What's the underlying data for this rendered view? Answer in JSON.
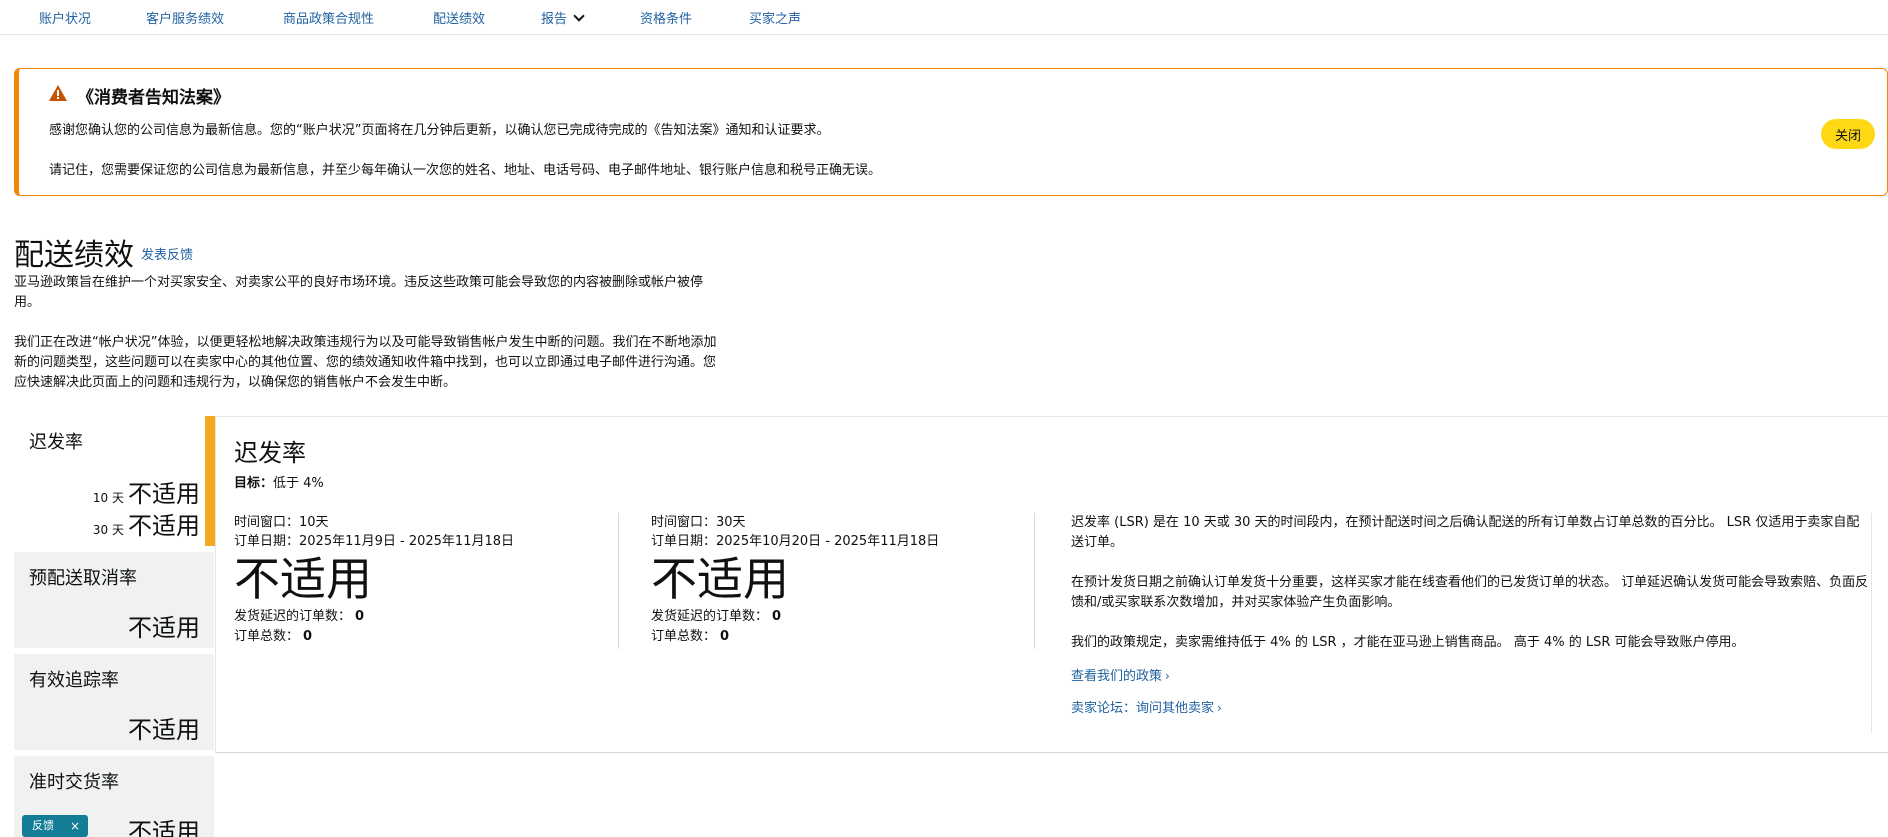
{
  "nav": {
    "items": [
      "账户状况",
      "客户服务绩效",
      "商品政策合规性",
      "配送绩效",
      "报告",
      "资格条件",
      "买家之声"
    ]
  },
  "alert": {
    "title": "《消费者告知法案》",
    "line1": "感谢您确认您的公司信息为最新信息。您的“账户状况”页面将在几分钟后更新，以确认您已完成待完成的《告知法案》通知和认证要求。",
    "line2": "请记住，您需要保证您的公司信息为最新信息，并至少每年确认一次您的姓名、地址、电话号码、电子邮件地址、银行账户信息和税号正确无误。",
    "close_label": "关闭",
    "accent_color": "#f08804"
  },
  "page": {
    "title": "配送绩效",
    "feedback_link": "发表反馈",
    "intro1": "亚马逊政策旨在维护一个对买家安全、对卖家公平的良好市场环境。违反这些政策可能会导致您的内容被删除或帐户被停用。",
    "intro2": "我们正在改进“帐户状况”体验，以便更轻松地解决政策违规行为以及可能导致销售帐户发生中断的问题。我们在不断地添加新的问题类型，这些问题可以在卖家中心的其他位置、您的绩效通知收件箱中找到，也可以立即通过电子邮件进行沟通。您应快速解决此页面上的问题和违规行为，以确保您的销售帐户不会发生中断。"
  },
  "metrics": [
    {
      "name": "迟发率",
      "rows": [
        {
          "period": "10 天",
          "value": "不适用"
        },
        {
          "period": "30 天",
          "value": "不适用"
        }
      ]
    },
    {
      "name": "预配送取消率",
      "value": "不适用"
    },
    {
      "name": "有效追踪率",
      "value": "不适用"
    },
    {
      "name": "准时交货率",
      "value": "不适用"
    }
  ],
  "feedback_pill": {
    "label": "反馈",
    "close": "×"
  },
  "detail": {
    "title": "迟发率",
    "goal_label": "目标：",
    "goal_value": "低于 4%",
    "windows": [
      {
        "window": "时间窗口：10天",
        "dates": "订单日期：2025年11月9日 - 2025年11月18日",
        "big": "不适用",
        "late_label": "发货延迟的订单数：",
        "late_value": "0",
        "total_label": "订单总数：",
        "total_value": "0"
      },
      {
        "window": "时间窗口：30天",
        "dates": "订单日期：2025年10月20日 - 2025年11月18日",
        "big": "不适用",
        "late_label": "发货延迟的订单数：",
        "late_value": "0",
        "total_label": "订单总数：",
        "total_value": "0"
      }
    ],
    "desc1": "迟发率 (LSR) 是在 10 天或 30 天的时间段内，在预计配送时间之后确认配送的所有订单数占订单总数的百分比。 LSR 仅适用于卖家自配送订单。",
    "desc2": "在预计发货日期之前确认订单发货十分重要，这样买家才能在线查看他们的已发货订单的状态。 订单延迟确认发货可能会导致索赔、负面反馈和/或买家联系次数增加，并对买家体验产生负面影响。",
    "desc3": "我们的政策规定，卖家需维持低于 4% 的 LSR ，才能在亚马逊上销售商品。 高于 4% 的 LSR 可能会导致账户停用。",
    "link1": "查看我们的政策",
    "link2": "卖家论坛：询问其他卖家"
  }
}
